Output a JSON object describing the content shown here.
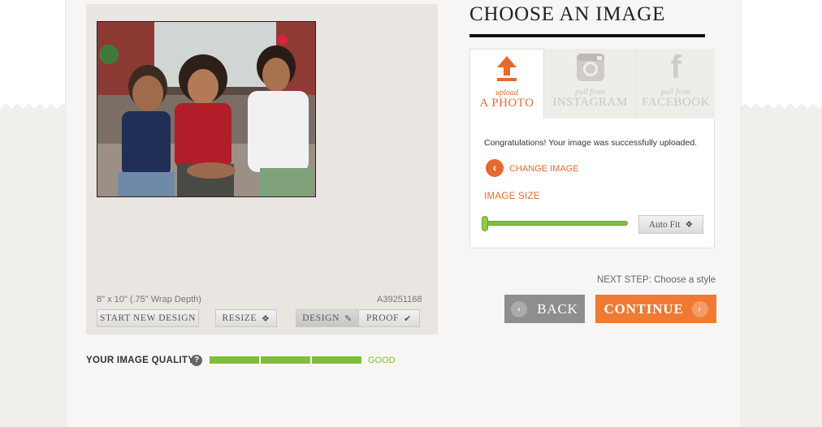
{
  "header": {
    "title": "CHOOSE AN IMAGE"
  },
  "tabs": [
    {
      "sub": "upload",
      "main": "A PHOTO",
      "icon": "upload-arrow-icon",
      "active": true
    },
    {
      "sub": "pull from",
      "main": "INSTAGRAM",
      "icon": "instagram-icon",
      "active": false
    },
    {
      "sub": "pull from",
      "main": "FACEBOOK",
      "icon": "facebook-icon",
      "active": false
    }
  ],
  "upload": {
    "success_message": "Congratulations! Your image was successfully uploaded.",
    "change_image_label": "CHANGE IMAGE",
    "image_size_label": "IMAGE SIZE",
    "slider_value": 0,
    "auto_fit_label": "Auto Fit"
  },
  "navigation": {
    "next_step_label": "NEXT STEP:",
    "next_step_value": "Choose a style",
    "back_label": "BACK",
    "continue_label": "CONTINUE"
  },
  "preview": {
    "size_label": "8\" x 10\" (.75\" Wrap Depth)",
    "sku": "A39251168",
    "start_new_label": "START NEW DESIGN",
    "resize_label": "RESIZE",
    "design_label": "DESIGN",
    "proof_label": "PROOF"
  },
  "quality": {
    "label": "YOUR IMAGE QUALITY",
    "help": "?",
    "segments_filled": 3,
    "segments_total": 3,
    "status": "GOOD"
  },
  "colors": {
    "accent": "#f07a32",
    "accent_text": "#e8692e",
    "good_green": "#7fbf3b",
    "back_grey": "#8e8e8e"
  }
}
